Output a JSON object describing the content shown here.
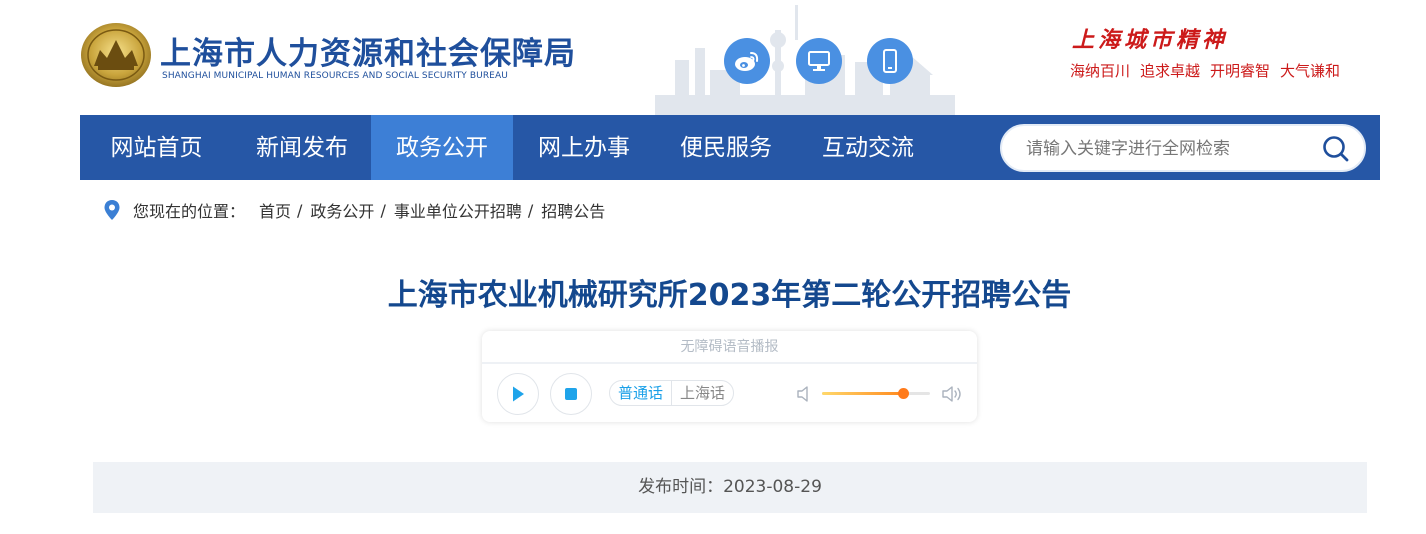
{
  "header": {
    "site_title": "上海市人力资源和社会保障局",
    "site_subtitle": "SHANGHAI MUNICIPAL HUMAN RESOURCES AND SOCIAL SECURITY BUREAU",
    "top_icons": [
      "weibo-icon",
      "desktop-icon",
      "mobile-icon"
    ],
    "spirit_title": "上海城市精神",
    "spirit_items": [
      "海纳百川",
      "追求卓越",
      "开明睿智",
      "大气谦和"
    ]
  },
  "nav": {
    "items": [
      "网站首页",
      "新闻发布",
      "政务公开",
      "网上办事",
      "便民服务",
      "互动交流"
    ],
    "active_index": 2,
    "search_placeholder": "请输入关键字进行全网检索"
  },
  "breadcrumb": {
    "label": "您现在的位置：",
    "items": [
      "首页",
      "政务公开",
      "事业单位公开招聘",
      "招聘公告"
    ]
  },
  "article": {
    "title": "上海市农业机械研究所2023年第二轮公开招聘公告",
    "publish_label": "发布时间：",
    "publish_date": "2023-08-29"
  },
  "player": {
    "header": "无障碍语音播报",
    "languages": [
      "普通话",
      "上海话"
    ],
    "active_language": "普通话",
    "volume": 0.75
  },
  "colors": {
    "nav_bg": "#2657a6",
    "nav_active": "#3d7fd6",
    "title": "#14488e",
    "spirit": "#cc1a1a",
    "icon_circle": "#4a90e2"
  }
}
